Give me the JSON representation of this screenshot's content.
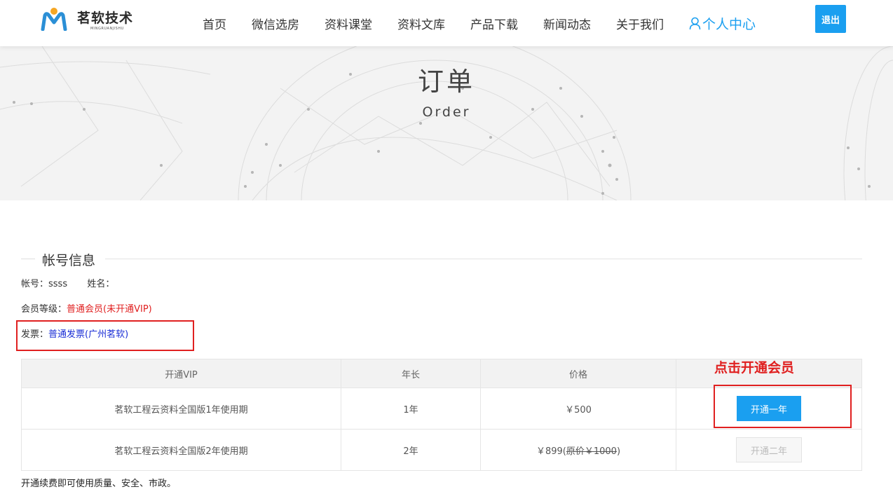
{
  "header": {
    "logo_text": "茗软技术",
    "logo_sub": "MINGRUANJISHU",
    "nav": [
      "首页",
      "微信选房",
      "资料课堂",
      "资料文库",
      "产品下载",
      "新闻动态",
      "关于我们"
    ],
    "user_center": "个人中心",
    "logout": "退出",
    "accent_color": "#1a9ff0"
  },
  "banner": {
    "title": "订单",
    "subtitle": "Order"
  },
  "account": {
    "section_title": "帐号信息",
    "account_label": "帐号：",
    "account_value": "ssss",
    "name_label": "姓名：",
    "name_value": "",
    "level_label": "会员等级：",
    "level_value": "普通会员(未开通VIP)",
    "invoice_label": "发票：",
    "invoice_value": "普通发票(广州茗软)"
  },
  "annotation": "点击开通会员",
  "table": {
    "headers": [
      "开通VIP",
      "年长",
      "价格",
      ""
    ],
    "rows": [
      {
        "name": "茗软工程云资料全国版1年使用期",
        "years": "1年",
        "price": "￥500",
        "original": "",
        "action": "开通一年",
        "enabled": true
      },
      {
        "name": "茗软工程云资料全国版2年使用期",
        "years": "2年",
        "price": "￥899(",
        "original": "原价￥1000",
        "price_end": ")",
        "action": "开通二年",
        "enabled": false
      }
    ]
  },
  "footer_note": "开通续费即可使用质量、安全、市政。"
}
